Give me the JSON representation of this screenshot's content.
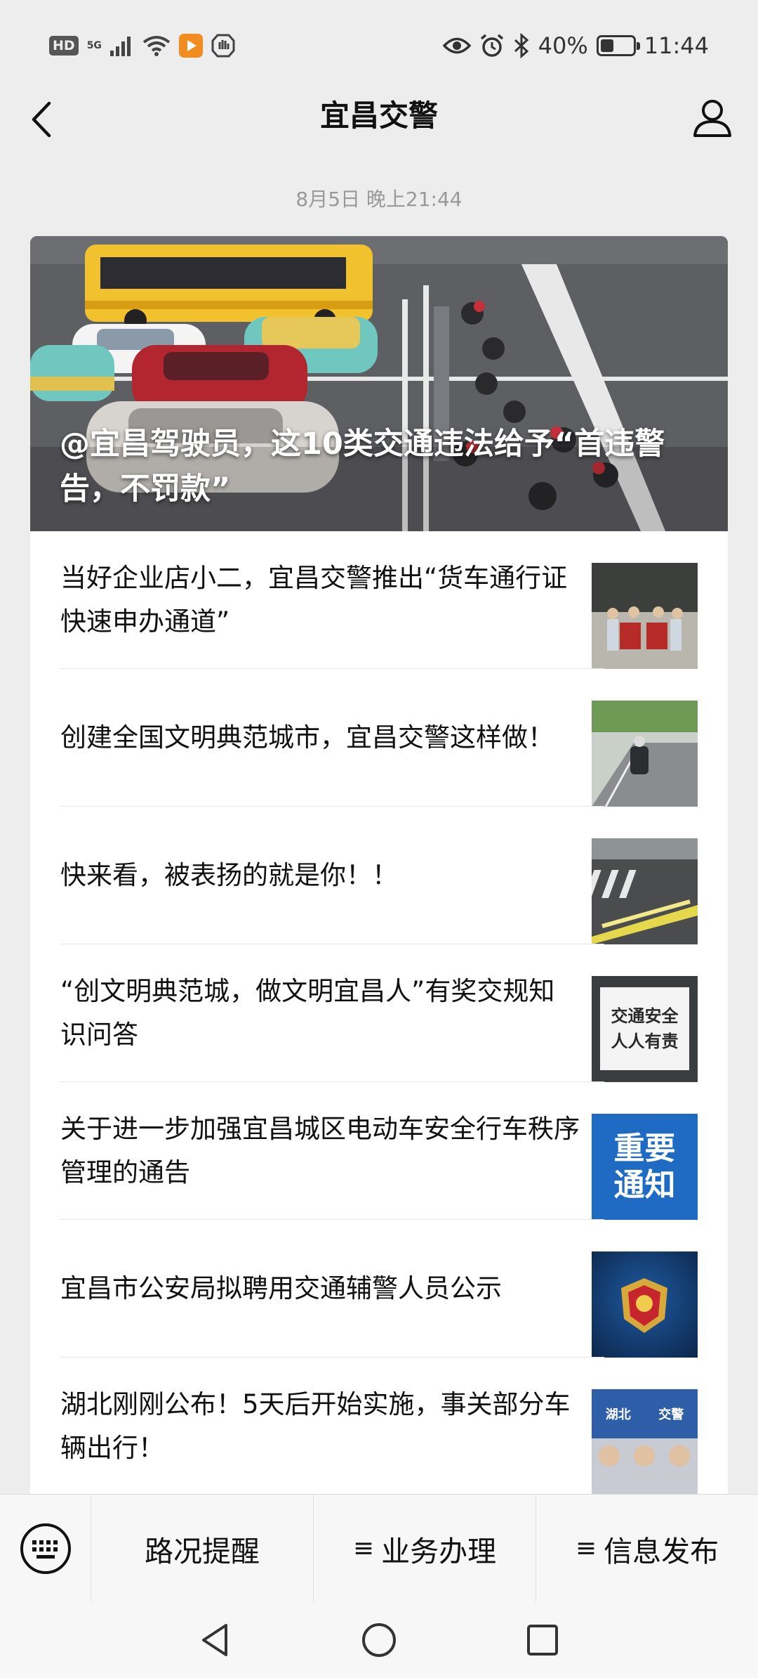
{
  "status_bar": {
    "hd": "HD",
    "network": "5G",
    "battery_percent": "40%",
    "battery_level": 0.4,
    "time": "11:44",
    "icons": [
      "signal-icon",
      "wifi-icon",
      "video-app-icon",
      "hand-icon",
      "eye-icon",
      "alarm-icon",
      "bluetooth-icon",
      "battery-icon"
    ]
  },
  "header": {
    "title": "宜昌交警",
    "back_icon": "chevron-left-icon",
    "profile_icon": "person-icon"
  },
  "timestamp": "8月5日 晚上21:44",
  "hero_article": {
    "title": "@宜昌驾驶员，这10类交通违法给予“首违警告，不罚款”"
  },
  "articles": [
    {
      "title": "当好企业店小二，宜昌交警推出“货车通行证快速申办通道”"
    },
    {
      "title": "创建全国文明典范城市，宜昌交警这样做！"
    },
    {
      "title": "快来看，被表扬的就是你！！"
    },
    {
      "title": "“创文明典范城，做文明宜昌人”有奖交规知识问答",
      "thumb_text": [
        "交通安全",
        "人人有责"
      ]
    },
    {
      "title": "关于进一步加强宜昌城区电动车安全行车秩序管理的通告",
      "thumb_text": [
        "重要",
        "通知"
      ]
    },
    {
      "title": "宜昌市公安局拟聘用交通辅警人员公示"
    },
    {
      "title": "湖北刚刚公布！5天后开始实施，事关部分车辆出行！",
      "thumb_text": [
        "湖北",
        "交警"
      ]
    }
  ],
  "bottom_menu": {
    "keyboard_icon": "keyboard-icon",
    "items": [
      {
        "label": "路况提醒",
        "prefix": ""
      },
      {
        "label": "业务办理",
        "prefix": "≡"
      },
      {
        "label": "信息发布",
        "prefix": "≡"
      }
    ]
  },
  "nav_bar": {
    "icons": [
      "back-triangle-icon",
      "home-circle-icon",
      "recents-square-icon"
    ]
  }
}
